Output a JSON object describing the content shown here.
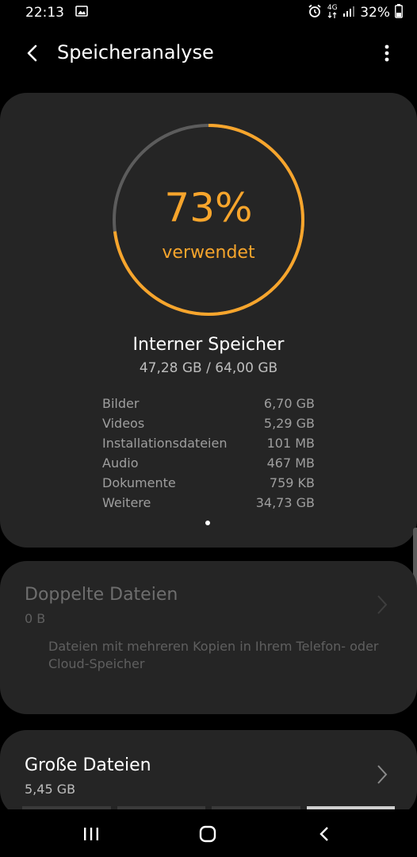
{
  "status_bar": {
    "time": "22:13",
    "network": "4G",
    "battery": "32%",
    "icons": [
      "image-icon",
      "alarm-icon",
      "network-4g-icon",
      "signal-icon",
      "battery-icon"
    ]
  },
  "app_bar": {
    "title": "Speicheranalyse",
    "back_icon": "back-arrow-icon",
    "menu_icon": "more-vert-icon"
  },
  "storage": {
    "percent_used": 73,
    "percent_text": "73%",
    "percent_label": "verwendet",
    "title": "Interner Speicher",
    "used_text": "47,28 GB / 64,00 GB",
    "accent_color": "#f7a52c",
    "breakdown": [
      {
        "label": "Bilder",
        "value": "6,70 GB"
      },
      {
        "label": "Videos",
        "value": "5,29 GB"
      },
      {
        "label": "Installationsdateien",
        "value": "101 MB"
      },
      {
        "label": "Audio",
        "value": "467 MB"
      },
      {
        "label": "Dokumente",
        "value": "759 KB"
      },
      {
        "label": "Weitere",
        "value": "34,73 GB"
      }
    ]
  },
  "duplicates": {
    "title": "Doppelte Dateien",
    "size": "0 B",
    "description": "Dateien mit mehreren Kopien in Ihrem Telefon- oder Cloud-Speicher"
  },
  "large_files": {
    "title": "Große Dateien",
    "size": "5,45 GB"
  },
  "nav_bar": {
    "icons": [
      "recent-apps-icon",
      "home-icon",
      "back-icon"
    ]
  }
}
